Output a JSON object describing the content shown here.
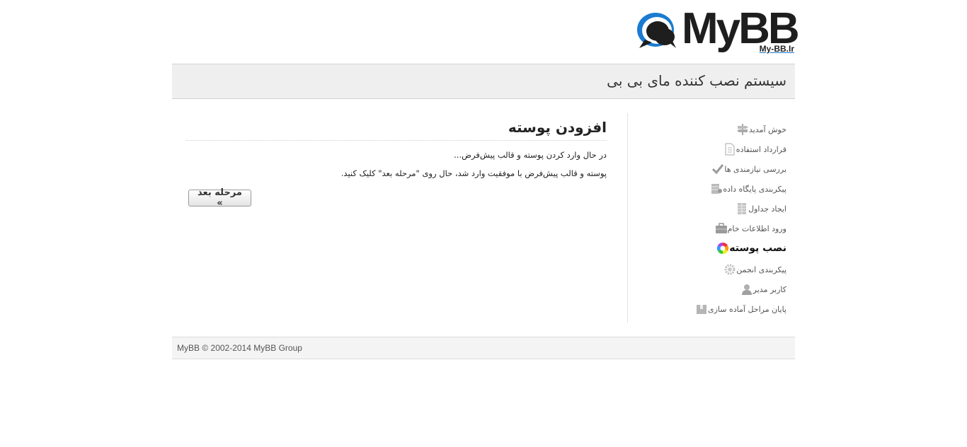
{
  "logo": {
    "word": "MyBB",
    "sub": "My-BB.Ir"
  },
  "header": {
    "title": "سیستم نصب کننده مای بی بی"
  },
  "sidebar": {
    "steps": [
      {
        "label": "خوش آمدید",
        "icon": "signpost-icon",
        "active": false
      },
      {
        "label": "قرارداد استفاده",
        "icon": "document-icon",
        "active": false
      },
      {
        "label": "بررسی نیازمندی ها",
        "icon": "checkmark-icon",
        "active": false
      },
      {
        "label": "پیکربندی پایگاه داده",
        "icon": "database-config-icon",
        "active": false
      },
      {
        "label": "ایجاد جداول",
        "icon": "table-icon",
        "active": false
      },
      {
        "label": "ورود اطلاعات خام",
        "icon": "briefcase-icon",
        "active": false
      },
      {
        "label": "نصب پوسته",
        "icon": "color-wheel-icon",
        "active": true
      },
      {
        "label": "پیکربندی انجمن",
        "icon": "gear-icon",
        "active": false
      },
      {
        "label": "کاربر مدیر",
        "icon": "user-icon",
        "active": false
      },
      {
        "label": "پایان مراحل آماده سازی",
        "icon": "box-icon",
        "active": false
      }
    ]
  },
  "main": {
    "heading": "افزودن پوسته",
    "line1": "در حال وارد کردن پوسته و قالب پیش‌فرض...",
    "line2": "پوسته و قالب پیش‌فرض با موفقیت وارد شد، حال روی \"مرحله بعد\" کلیک کنید.",
    "next_button": "مرحله بعد »"
  },
  "footer": {
    "copyright": "MyBB © 2002-2014 MyBB Group"
  },
  "colors": {
    "logo_blue": "#1a7bd0",
    "header_bg": "#efefef",
    "footer_bg": "#f4f4f4"
  }
}
